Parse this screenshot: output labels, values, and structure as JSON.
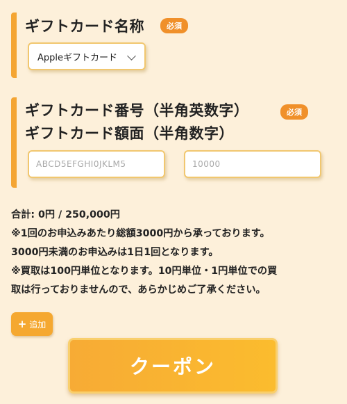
{
  "gift_name_section": {
    "title": "ギフトカード名称",
    "required_badge": "必須",
    "selected_option": "Appleギフトカード"
  },
  "gift_number_section": {
    "title_line1": "ギフトカード番号（半角英数字）",
    "title_line2": "ギフトカード額面（半角数字）",
    "required_badge": "必須",
    "code_placeholder": "ABCD5EFGHI0JKLM5",
    "amount_placeholder": "10000"
  },
  "info": {
    "total_label": "合計: ",
    "total_value": "0円 / 250,000円",
    "note1": "※1回のお申込みあたり総額3000円から承っております。",
    "note2": "3000円未満のお申込みは1日1回となります。",
    "note3_line1": "※買取は100円単位となります。10円単位・1円単位での買",
    "note3_line2": "取は行っておりませんので、あらかじめご了承ください。"
  },
  "add_button": {
    "icon": "plus-icon",
    "label": "追加"
  },
  "coupon_button": {
    "label": "クーポン"
  },
  "colors": {
    "accent": "#f4a533",
    "badge": "#f0902a",
    "background": "#fdf0da",
    "input_border": "#f1c76f"
  }
}
